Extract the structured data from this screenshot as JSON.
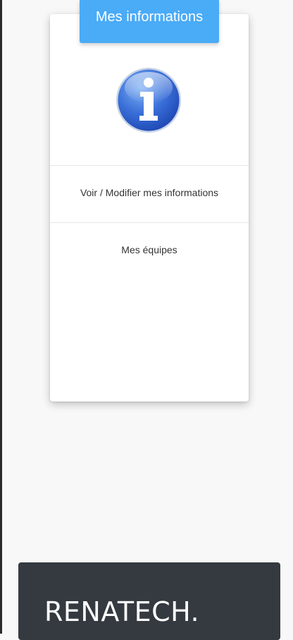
{
  "card": {
    "header_title": "Mes informations",
    "icon": "info-icon",
    "links": [
      {
        "label": "Voir / Modifier mes informations"
      },
      {
        "label": "Mes équipes"
      }
    ]
  },
  "footer": {
    "brand": "RENATECH."
  },
  "colors": {
    "header_bg": "#4aabf6",
    "icon_blue": "#3a6fd8",
    "footer_bg": "#343a40",
    "page_bg": "#f8f8f8"
  }
}
